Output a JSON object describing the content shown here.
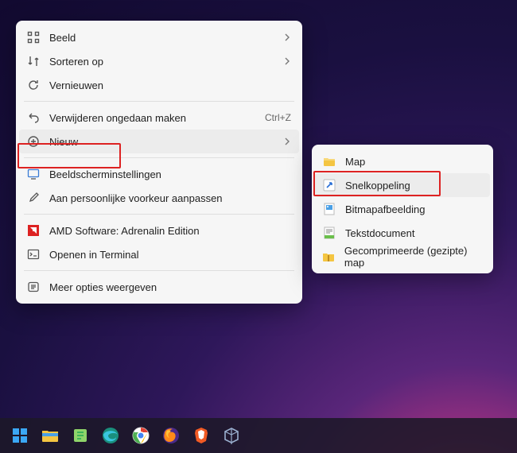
{
  "contextMenu": {
    "items": [
      {
        "label": "Beeld",
        "hasSubmenu": true
      },
      {
        "label": "Sorteren op",
        "hasSubmenu": true
      },
      {
        "label": "Vernieuwen"
      },
      {
        "label": "Verwijderen ongedaan maken",
        "accelerator": "Ctrl+Z"
      },
      {
        "label": "Nieuw",
        "hasSubmenu": true,
        "hovered": true
      },
      {
        "label": "Beeldscherminstellingen"
      },
      {
        "label": "Aan persoonlijke voorkeur aanpassen"
      },
      {
        "label": "AMD Software: Adrenalin Edition"
      },
      {
        "label": "Openen in Terminal"
      },
      {
        "label": "Meer opties weergeven"
      }
    ]
  },
  "submenu": {
    "items": [
      {
        "label": "Map"
      },
      {
        "label": "Snelkoppeling",
        "hovered": true
      },
      {
        "label": "Bitmapafbeelding"
      },
      {
        "label": "Tekstdocument"
      },
      {
        "label": "Gecomprimeerde (gezipte) map"
      }
    ]
  }
}
